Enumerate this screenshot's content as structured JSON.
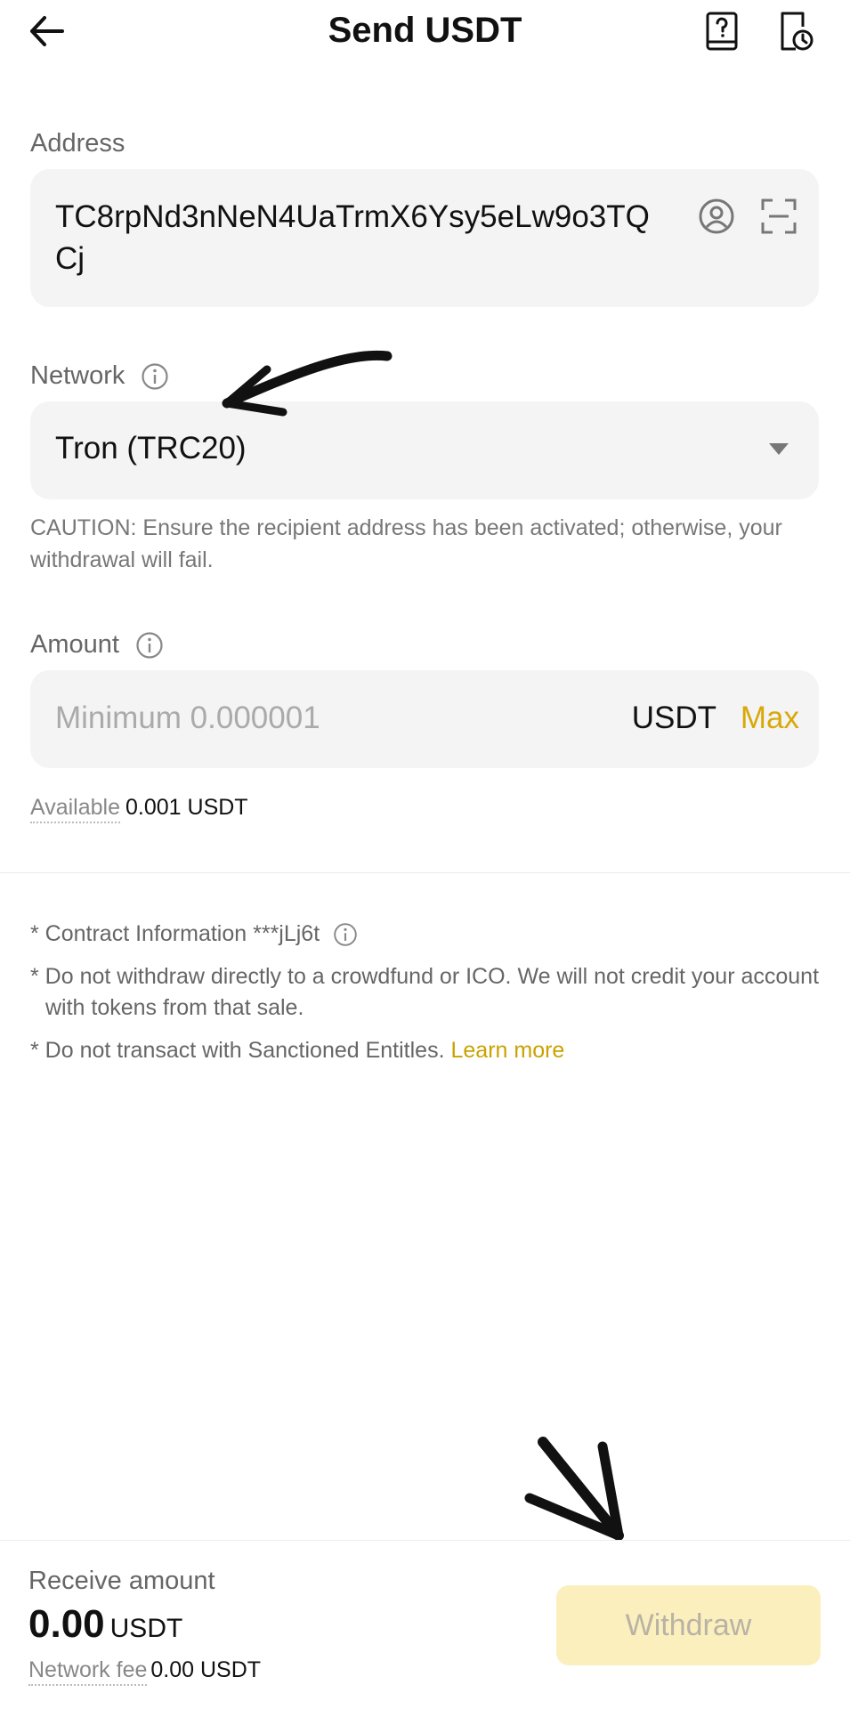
{
  "header": {
    "title": "Send USDT",
    "icons": [
      "back-arrow-icon",
      "help-guide-icon",
      "history-icon"
    ]
  },
  "address": {
    "label": "Address",
    "value": "TC8rpNd3nNeN4UaTrmX6Ysy5eLw9o3TQCj",
    "icons": [
      "contact-icon",
      "scan-icon"
    ]
  },
  "network": {
    "label": "Network",
    "selected": "Tron (TRC20)",
    "caution": "CAUTION: Ensure the recipient address has been activated; otherwise, your withdrawal will fail."
  },
  "amount": {
    "label": "Amount",
    "placeholder": "Minimum 0.000001",
    "unit": "USDT",
    "max_label": "Max",
    "available_label": "Available",
    "available_value": "0.001 USDT"
  },
  "notes": {
    "contract": "* Contract Information ***jLj6t",
    "crowdfund": "* Do not withdraw directly to a crowdfund or ICO. We will not credit your account with tokens from that sale.",
    "sanctioned": "* Do not transact with Sanctioned Entitles. ",
    "learn_more": "Learn more"
  },
  "footer": {
    "receive_label": "Receive amount",
    "receive_value": "0.00",
    "receive_unit": "USDT",
    "fee_label": "Network fee",
    "fee_value": "0.00 USDT",
    "withdraw_label": "Withdraw"
  },
  "colors": {
    "accent": "#d9a806",
    "withdraw_bg": "#fcefbe",
    "input_bg": "#f4f4f4"
  }
}
